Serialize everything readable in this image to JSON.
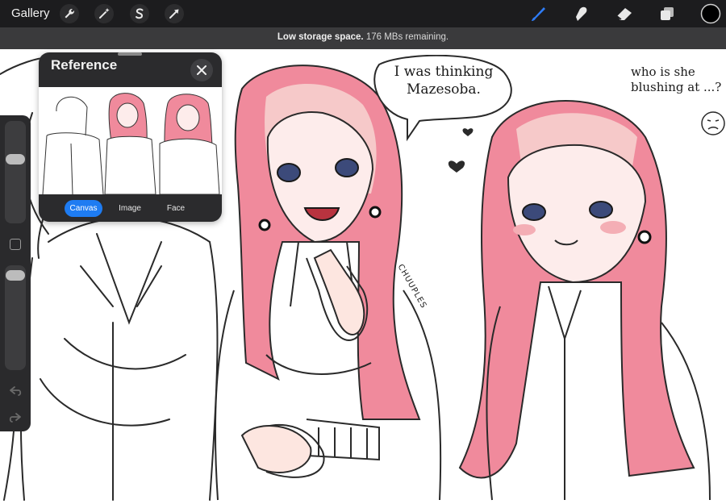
{
  "toolbar": {
    "gallery_label": "Gallery",
    "left_tools": [
      "wrench-icon",
      "magic-wand-icon",
      "selection-icon",
      "transform-arrow-icon"
    ],
    "right_tools": [
      "brush-icon",
      "smudge-icon",
      "eraser-icon",
      "layers-icon",
      "color-swatch-icon"
    ],
    "accent_color": "#2e7cf6",
    "active_color": "#000000"
  },
  "notice": {
    "bold_text": "Low storage space.",
    "detail_text": " 176 MBs remaining."
  },
  "reference": {
    "title": "Reference",
    "tabs": [
      {
        "label": "Canvas",
        "active": true
      },
      {
        "label": "Image",
        "active": false
      },
      {
        "label": "Face",
        "active": false
      }
    ]
  },
  "canvas": {
    "speech_text": "I was thinking Mazesoba.",
    "note_text": "who is she blushing at ...?",
    "signature": "CHUUPLES"
  }
}
